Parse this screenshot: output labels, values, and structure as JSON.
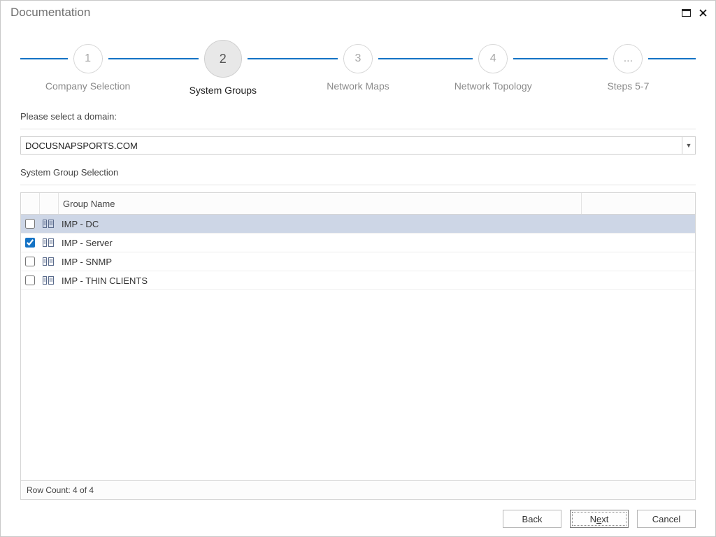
{
  "window": {
    "title": "Documentation"
  },
  "stepper": {
    "steps": [
      {
        "num": "1",
        "label": "Company Selection",
        "active": false
      },
      {
        "num": "2",
        "label": "System Groups",
        "active": true
      },
      {
        "num": "3",
        "label": "Network Maps",
        "active": false
      },
      {
        "num": "4",
        "label": "Network Topology",
        "active": false
      },
      {
        "num": "...",
        "label": "Steps 5-7",
        "active": false
      }
    ]
  },
  "domain": {
    "label": "Please select a domain:",
    "value": "DOCUSNAPSPORTS.COM"
  },
  "group_selection": {
    "label": "System Group Selection",
    "column_header": "Group Name",
    "rows": [
      {
        "checked": false,
        "name": "IMP - DC",
        "selected": true
      },
      {
        "checked": true,
        "name": "IMP - Server",
        "selected": false
      },
      {
        "checked": false,
        "name": "IMP - SNMP",
        "selected": false
      },
      {
        "checked": false,
        "name": "IMP - THIN CLIENTS",
        "selected": false
      }
    ],
    "row_count_label": "Row Count: 4 of 4"
  },
  "buttons": {
    "back": "Back",
    "next_pre": "N",
    "next_mnemonic": "e",
    "next_post": "xt",
    "cancel": "Cancel"
  }
}
